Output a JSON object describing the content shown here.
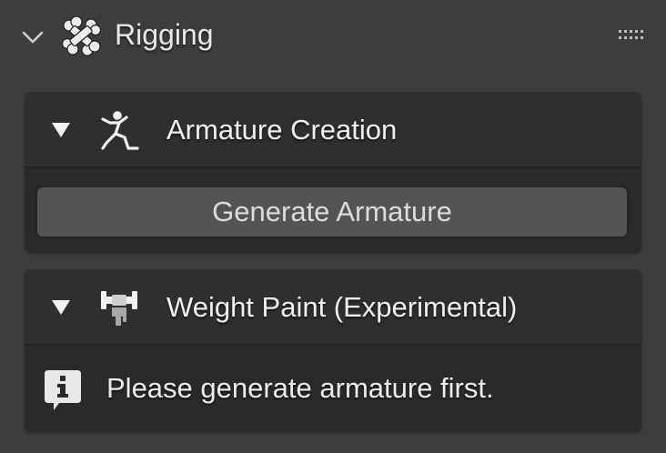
{
  "panel": {
    "title": "Rigging",
    "icons": {
      "collapse": "chevron-down-icon",
      "panel": "bone-icon",
      "drag": "drag-handle-icon"
    }
  },
  "armature_creation": {
    "title": "Armature Creation",
    "icon": "armature-icon",
    "disclosure_icon": "triangle-down-icon",
    "generate_button": "Generate Armature"
  },
  "weight_paint": {
    "title": "Weight Paint (Experimental)",
    "icon": "weight-paint-icon",
    "disclosure_icon": "triangle-down-icon",
    "info_icon": "info-icon",
    "message": "Please generate armature first."
  },
  "colors": {
    "background": "#3d3d3d",
    "subpanel": "#2b2b2b",
    "button": "#545454",
    "text": "#e6e6e6"
  }
}
